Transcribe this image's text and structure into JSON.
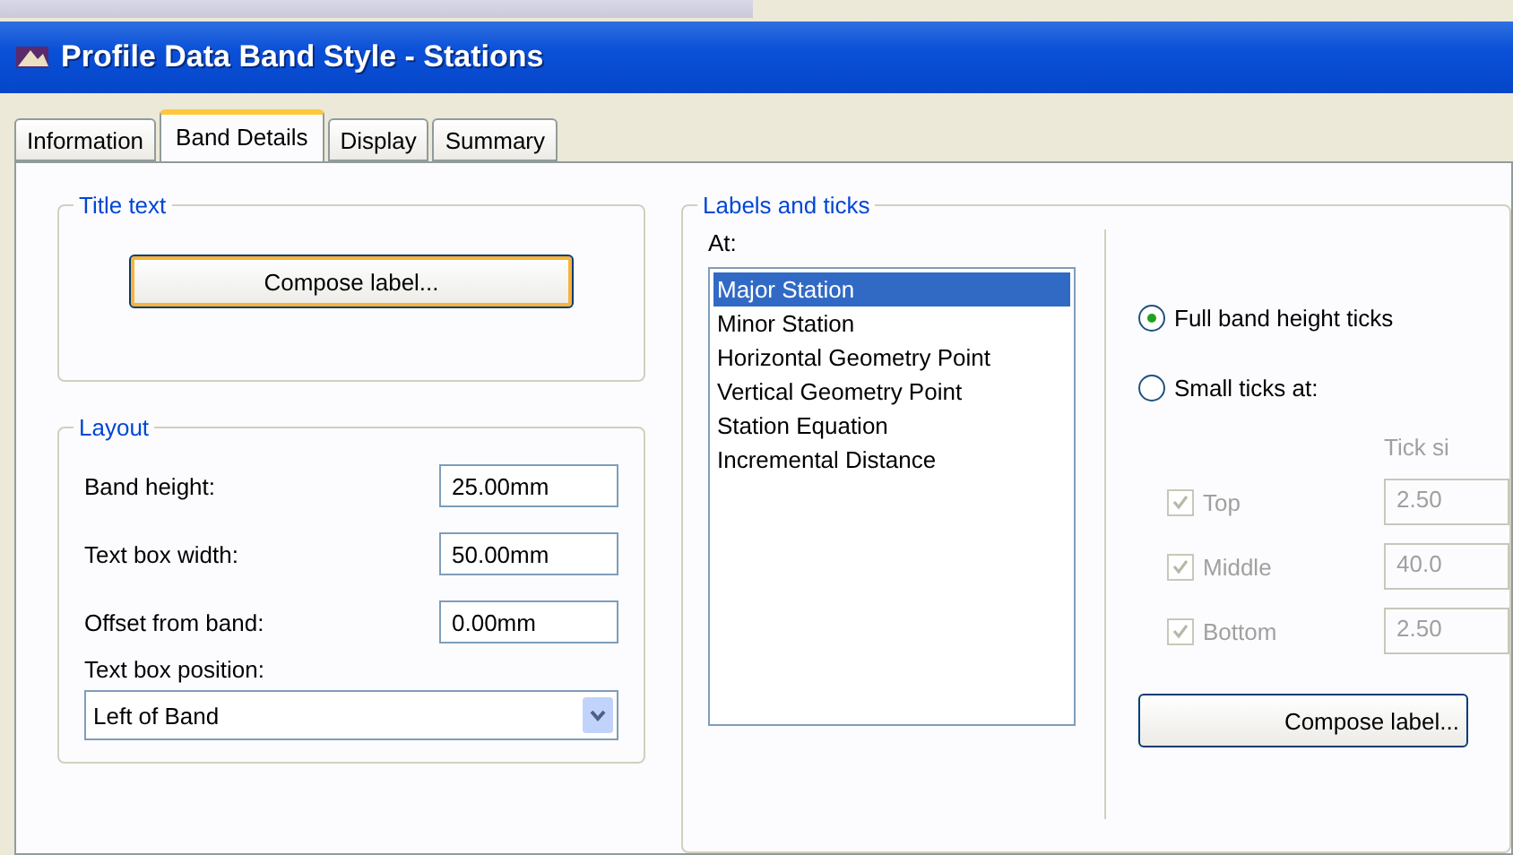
{
  "window": {
    "title": "Profile Data Band Style - Stations"
  },
  "tabs": [
    {
      "label": "Information",
      "selected": false
    },
    {
      "label": "Band Details",
      "selected": true
    },
    {
      "label": "Display",
      "selected": false
    },
    {
      "label": "Summary",
      "selected": false
    }
  ],
  "title_text": {
    "legend": "Title text",
    "button": "Compose label..."
  },
  "layout": {
    "legend": "Layout",
    "fields": [
      {
        "label": "Band height:",
        "value": "25.00mm"
      },
      {
        "label": "Text box width:",
        "value": "50.00mm"
      },
      {
        "label": "Offset from band:",
        "value": "0.00mm"
      }
    ],
    "position_label": "Text box position:",
    "position_value": "Left of Band"
  },
  "labels_and_ticks": {
    "legend": "Labels and ticks",
    "at_label": "At:",
    "items": [
      {
        "label": "Major Station",
        "selected": true
      },
      {
        "label": "Minor Station",
        "selected": false
      },
      {
        "label": "Horizontal Geometry Point",
        "selected": false
      },
      {
        "label": "Vertical Geometry Point",
        "selected": false
      },
      {
        "label": "Station Equation",
        "selected": false
      },
      {
        "label": "Incremental Distance",
        "selected": false
      }
    ],
    "radios": [
      {
        "label": "Full band height ticks",
        "selected": true
      },
      {
        "label": "Small ticks at:",
        "selected": false
      }
    ],
    "tick_size_header": "Tick si",
    "ticks": [
      {
        "label": "Top",
        "checked": true,
        "disabled": true,
        "value": "2.50"
      },
      {
        "label": "Middle",
        "checked": true,
        "disabled": true,
        "value": "40.0"
      },
      {
        "label": "Bottom",
        "checked": true,
        "disabled": true,
        "value": "2.50"
      }
    ],
    "button": "Compose label..."
  }
}
